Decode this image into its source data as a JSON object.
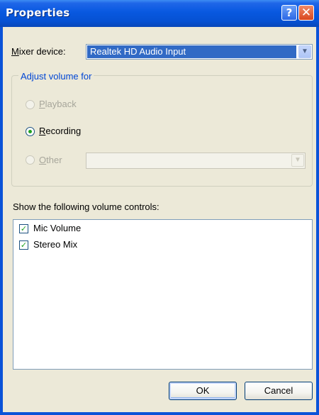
{
  "window": {
    "title": "Properties",
    "help_glyph": "?",
    "close_glyph": "✕"
  },
  "mixer": {
    "label": "ixer device:",
    "label_accel": "M",
    "selected_value": "Realtek HD Audio Input",
    "dropdown_glyph": "▼"
  },
  "adjust_group": {
    "legend": "Adjust volume for",
    "options": [
      {
        "accel": "P",
        "rest": "layback",
        "checked": false,
        "enabled": false
      },
      {
        "accel": "R",
        "rest": "ecording",
        "checked": true,
        "enabled": true
      },
      {
        "accel": "O",
        "rest": "ther",
        "checked": false,
        "enabled": false
      }
    ],
    "other_select_value": "",
    "other_dropdown_glyph": "▼"
  },
  "controls": {
    "label": "Show the following volume controls:",
    "items": [
      {
        "label": "Mic Volume",
        "checked": true
      },
      {
        "label": "Stereo Mix",
        "checked": true
      }
    ],
    "check_glyph": "✓"
  },
  "buttons": {
    "ok": "OK",
    "cancel": "Cancel"
  },
  "colors": {
    "titlebar": "#0858e0",
    "dialog_bg": "#ece9d8",
    "selection": "#316ac5",
    "group_legend": "#0046d5",
    "check_green": "#21a121"
  }
}
